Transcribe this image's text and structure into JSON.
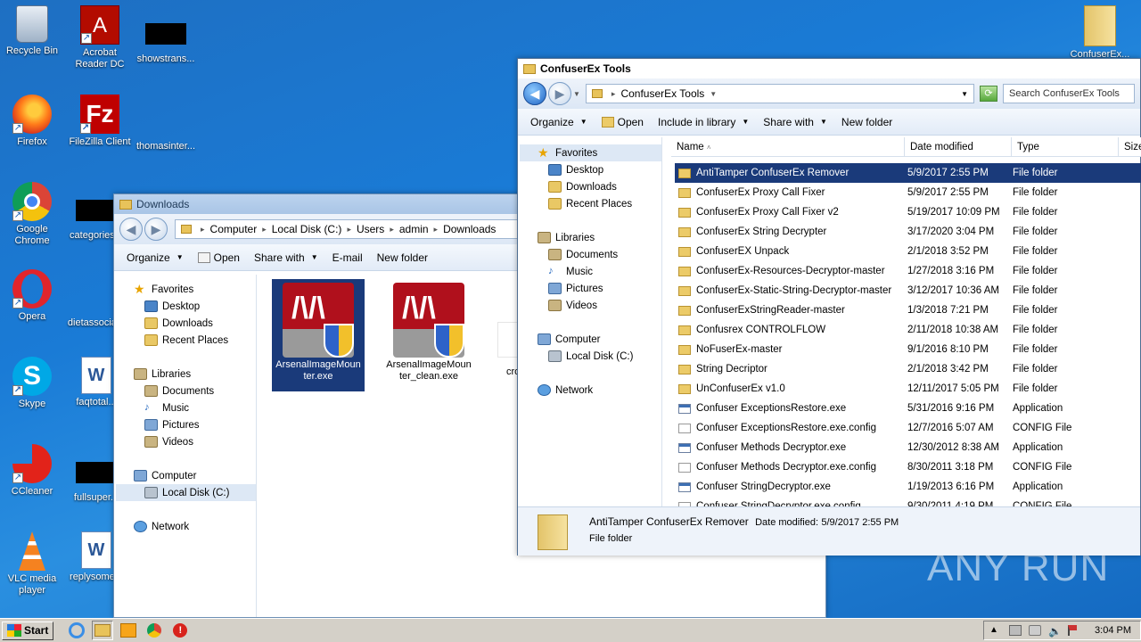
{
  "desktop": {
    "icons": [
      {
        "label": "Recycle Bin"
      },
      {
        "label": "Acrobat Reader DC"
      },
      {
        "label": "showstrans..."
      },
      {
        "label": "Firefox"
      },
      {
        "label": "FileZilla Client"
      },
      {
        "label": "thomasinter..."
      },
      {
        "label": "Google Chrome"
      },
      {
        "label": "categories..."
      },
      {
        "label": "Opera"
      },
      {
        "label": "dietassocia..."
      },
      {
        "label": "Skype"
      },
      {
        "label": "faqtotal..."
      },
      {
        "label": "CCleaner"
      },
      {
        "label": "fullsuper..."
      },
      {
        "label": "VLC media player"
      },
      {
        "label": "replysome..."
      },
      {
        "label": "ConfuserEx..."
      }
    ],
    "watermark": "ANY RUN"
  },
  "downloads_window": {
    "title": "Downloads",
    "breadcrumb": [
      "Computer",
      "Local Disk (C:)",
      "Users",
      "admin",
      "Downloads"
    ],
    "toolbar": {
      "organize": "Organize",
      "open": "Open",
      "share_with": "Share with",
      "email": "E-mail",
      "new_folder": "New folder"
    },
    "nav": {
      "favorites": "Favorites",
      "desktop": "Desktop",
      "downloads": "Downloads",
      "recent": "Recent Places",
      "libraries": "Libraries",
      "documents": "Documents",
      "music": "Music",
      "pictures": "Pictures",
      "videos": "Videos",
      "computer": "Computer",
      "local_disk": "Local Disk (C:)",
      "network": "Network"
    },
    "files": [
      {
        "name": "ArsenalImageMounter.exe",
        "name_l1": "ArsenalImageMoun",
        "name_l2": "ter.exe"
      },
      {
        "name": "ArsenalImageMounter_clean.exe",
        "name_l1": "ArsenalImageMoun",
        "name_l2": "ter_clean.exe"
      },
      {
        "name": "cro"
      }
    ]
  },
  "confuser_window": {
    "title": "ConfuserEx Tools",
    "breadcrumb": [
      "ConfuserEx Tools"
    ],
    "search_placeholder": "Search ConfuserEx Tools",
    "toolbar": {
      "organize": "Organize",
      "open": "Open",
      "include_in_library": "Include in library",
      "share_with": "Share with",
      "new_folder": "New folder"
    },
    "nav": {
      "favorites": "Favorites",
      "desktop": "Desktop",
      "downloads": "Downloads",
      "recent": "Recent Places",
      "libraries": "Libraries",
      "documents": "Documents",
      "music": "Music",
      "pictures": "Pictures",
      "videos": "Videos",
      "computer": "Computer",
      "local_disk": "Local Disk (C:)",
      "network": "Network"
    },
    "columns": {
      "name": "Name",
      "date": "Date modified",
      "type": "Type",
      "size": "Size"
    },
    "rows": [
      {
        "name": "AntiTamper ConfuserEx Remover",
        "date": "5/9/2017 2:55 PM",
        "type": "File folder",
        "kind": "folder"
      },
      {
        "name": "ConfuserEx Proxy Call Fixer",
        "date": "5/9/2017 2:55 PM",
        "type": "File folder",
        "kind": "folder"
      },
      {
        "name": "ConfuserEx Proxy Call Fixer v2",
        "date": "5/19/2017 10:09 PM",
        "type": "File folder",
        "kind": "folder"
      },
      {
        "name": "ConfuserEx String Decrypter",
        "date": "3/17/2020 3:04 PM",
        "type": "File folder",
        "kind": "folder"
      },
      {
        "name": "ConfuserEX Unpack",
        "date": "2/1/2018 3:52 PM",
        "type": "File folder",
        "kind": "folder"
      },
      {
        "name": "ConfuserEx-Resources-Decryptor-master",
        "date": "1/27/2018 3:16 PM",
        "type": "File folder",
        "kind": "folder"
      },
      {
        "name": "ConfuserEx-Static-String-Decryptor-master",
        "date": "3/12/2017 10:36 AM",
        "type": "File folder",
        "kind": "folder"
      },
      {
        "name": "ConfuserExStringReader-master",
        "date": "1/3/2018 7:21 PM",
        "type": "File folder",
        "kind": "folder"
      },
      {
        "name": "Confusrex CONTROLFLOW",
        "date": "2/11/2018 10:38 AM",
        "type": "File folder",
        "kind": "folder"
      },
      {
        "name": "NoFuserEx-master",
        "date": "9/1/2016 8:10 PM",
        "type": "File folder",
        "kind": "folder"
      },
      {
        "name": "String Decriptor",
        "date": "2/1/2018 3:42 PM",
        "type": "File folder",
        "kind": "folder"
      },
      {
        "name": "UnConfuserEx v1.0",
        "date": "12/11/2017 5:05 PM",
        "type": "File folder",
        "kind": "folder"
      },
      {
        "name": "Confuser ExceptionsRestore.exe",
        "date": "5/31/2016 9:16 PM",
        "type": "Application",
        "kind": "app"
      },
      {
        "name": "Confuser ExceptionsRestore.exe.config",
        "date": "12/7/2016 5:07 AM",
        "type": "CONFIG File",
        "kind": "cfg"
      },
      {
        "name": "Confuser Methods Decryptor.exe",
        "date": "12/30/2012 8:38 AM",
        "type": "Application",
        "kind": "app"
      },
      {
        "name": "Confuser Methods Decryptor.exe.config",
        "date": "8/30/2011 3:18 PM",
        "type": "CONFIG File",
        "kind": "cfg"
      },
      {
        "name": "Confuser StringDecryptor.exe",
        "date": "1/19/2013 6:16 PM",
        "type": "Application",
        "kind": "app"
      },
      {
        "name": "Confuser StringDecryptor.exe.config",
        "date": "9/30/2011 4:19 PM",
        "type": "CONFIG File",
        "kind": "cfg"
      }
    ],
    "details": {
      "name": "AntiTamper ConfuserEx Remover",
      "date_label": "Date modified:",
      "date": "5/9/2017 2:55 PM",
      "type": "File folder"
    }
  },
  "taskbar": {
    "start": "Start",
    "clock": "3:04 PM"
  }
}
